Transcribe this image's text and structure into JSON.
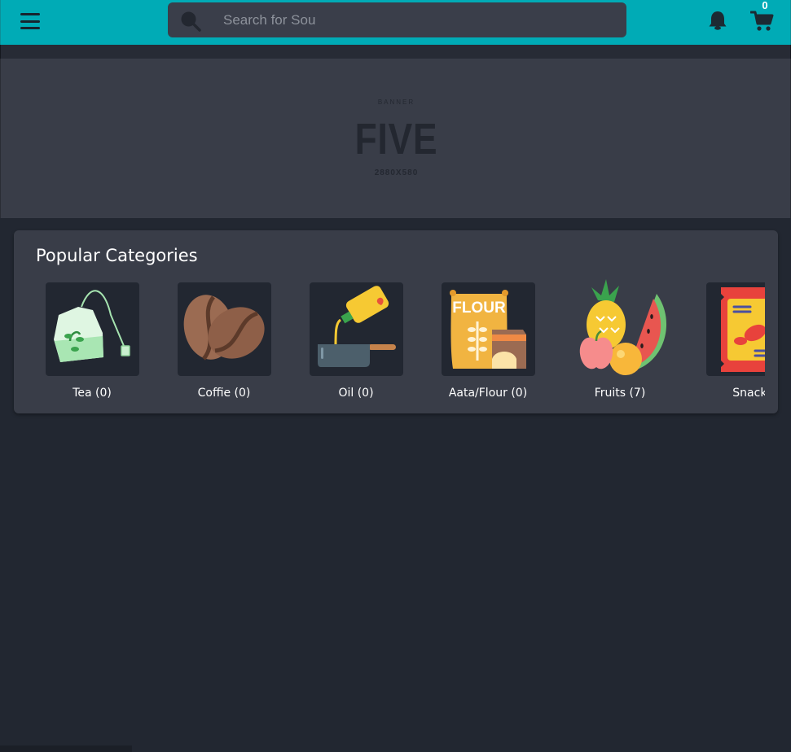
{
  "topbar": {
    "menu_icon": "hamburger-menu-icon",
    "search_placeholder": "Search for Sou",
    "search_value": "",
    "search_icon": "search-icon",
    "bell_icon": "bell-icon",
    "cart_icon": "cart-icon",
    "cart_count": "0"
  },
  "banner": {
    "small_label": "BANNER",
    "title": "FIVE",
    "size": "2880X580"
  },
  "categories": {
    "title": "Popular Categories",
    "items": [
      {
        "label": "Tea (0)",
        "icon": "tea-bag-icon"
      },
      {
        "label": "Coffie (0)",
        "icon": "coffee-beans-icon"
      },
      {
        "label": "Oil (0)",
        "icon": "cooking-oil-icon"
      },
      {
        "label": "Aata/Flour (0)",
        "icon": "flour-bag-icon",
        "image_text": "FLOUR"
      },
      {
        "label": "Fruits (7)",
        "icon": "fruits-icon"
      },
      {
        "label": "Snacks",
        "icon": "snacks-icon"
      }
    ]
  },
  "colors": {
    "topbar": "#00abb6",
    "page_background": "#222731",
    "card_background": "#393d48",
    "search_background": "#3a3e4a"
  }
}
